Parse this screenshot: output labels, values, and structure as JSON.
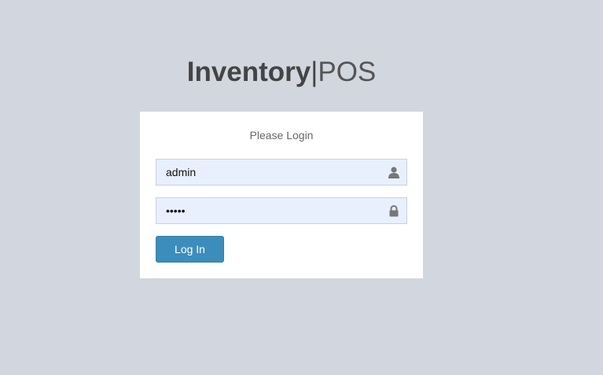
{
  "logo": {
    "bold": "Inventory",
    "separator": "|",
    "light": "POS"
  },
  "login_box": {
    "message": "Please Login",
    "username": {
      "value": "admin",
      "icon": "user-icon"
    },
    "password": {
      "value": "•••••",
      "icon": "lock-icon"
    },
    "submit_label": "Log In"
  },
  "colors": {
    "background": "#d2d6de",
    "input_fill": "#e8f0fe",
    "button": "#3c8dbc"
  }
}
